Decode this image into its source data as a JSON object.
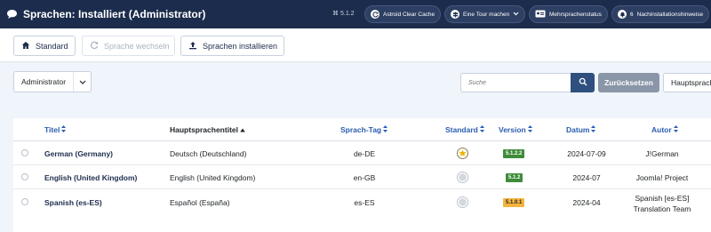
{
  "header": {
    "title": "Sprachen: Installiert (Administrator)",
    "version": "5.1.2",
    "buttons": [
      {
        "label": "Astroid Clear Cache",
        "icon": "refresh-icon"
      },
      {
        "label": "Eine Tour machen",
        "icon": "signpost-icon"
      },
      {
        "label": "Mehrsprachenstatus",
        "icon": "id-card-icon"
      },
      {
        "label": "Nachinstallationshinweise",
        "icon": "bell-icon",
        "count": "6"
      }
    ]
  },
  "toolbar": {
    "default_label": "Standard",
    "switch_label": "Sprache wechseln",
    "install_label": "Sprachen installieren"
  },
  "filters": {
    "client": "Administrator",
    "search_placeholder": "Suche",
    "reset_label": "Zurücksetzen",
    "sort_label": "Hauptsprachentitel aufsteigend"
  },
  "table": {
    "headers": {
      "title": "Titel",
      "native": "Hauptsprachentitel",
      "tag": "Sprach-Tag",
      "default": "Standard",
      "version": "Version",
      "date": "Datum",
      "author": "Autor"
    },
    "rows": [
      {
        "title": "German (Germany)",
        "native": "Deutsch (Deutschland)",
        "tag": "de-DE",
        "is_default": true,
        "version": "5.1.2.2",
        "version_status": "green",
        "date": "2024-07-09",
        "author": "J!German",
        "author2": ""
      },
      {
        "title": "English (United Kingdom)",
        "native": "English (United Kingdom)",
        "tag": "en-GB",
        "is_default": false,
        "version": "5.1.2",
        "version_status": "green",
        "date": "2024-07",
        "author": "Joomla! Project",
        "author2": ""
      },
      {
        "title": "Spanish (es-ES)",
        "native": "Español (España)",
        "tag": "es-ES",
        "is_default": false,
        "version": "5.1.0.1",
        "version_status": "orange",
        "date": "2024-04",
        "author": "Spanish [es-ES]",
        "author2": "Translation Team"
      }
    ]
  },
  "colors": {
    "header_bg": "#1c2c4c",
    "link_blue": "#2a5db0",
    "badge_green": "#3f8c3a",
    "badge_orange": "#f5b43d"
  }
}
